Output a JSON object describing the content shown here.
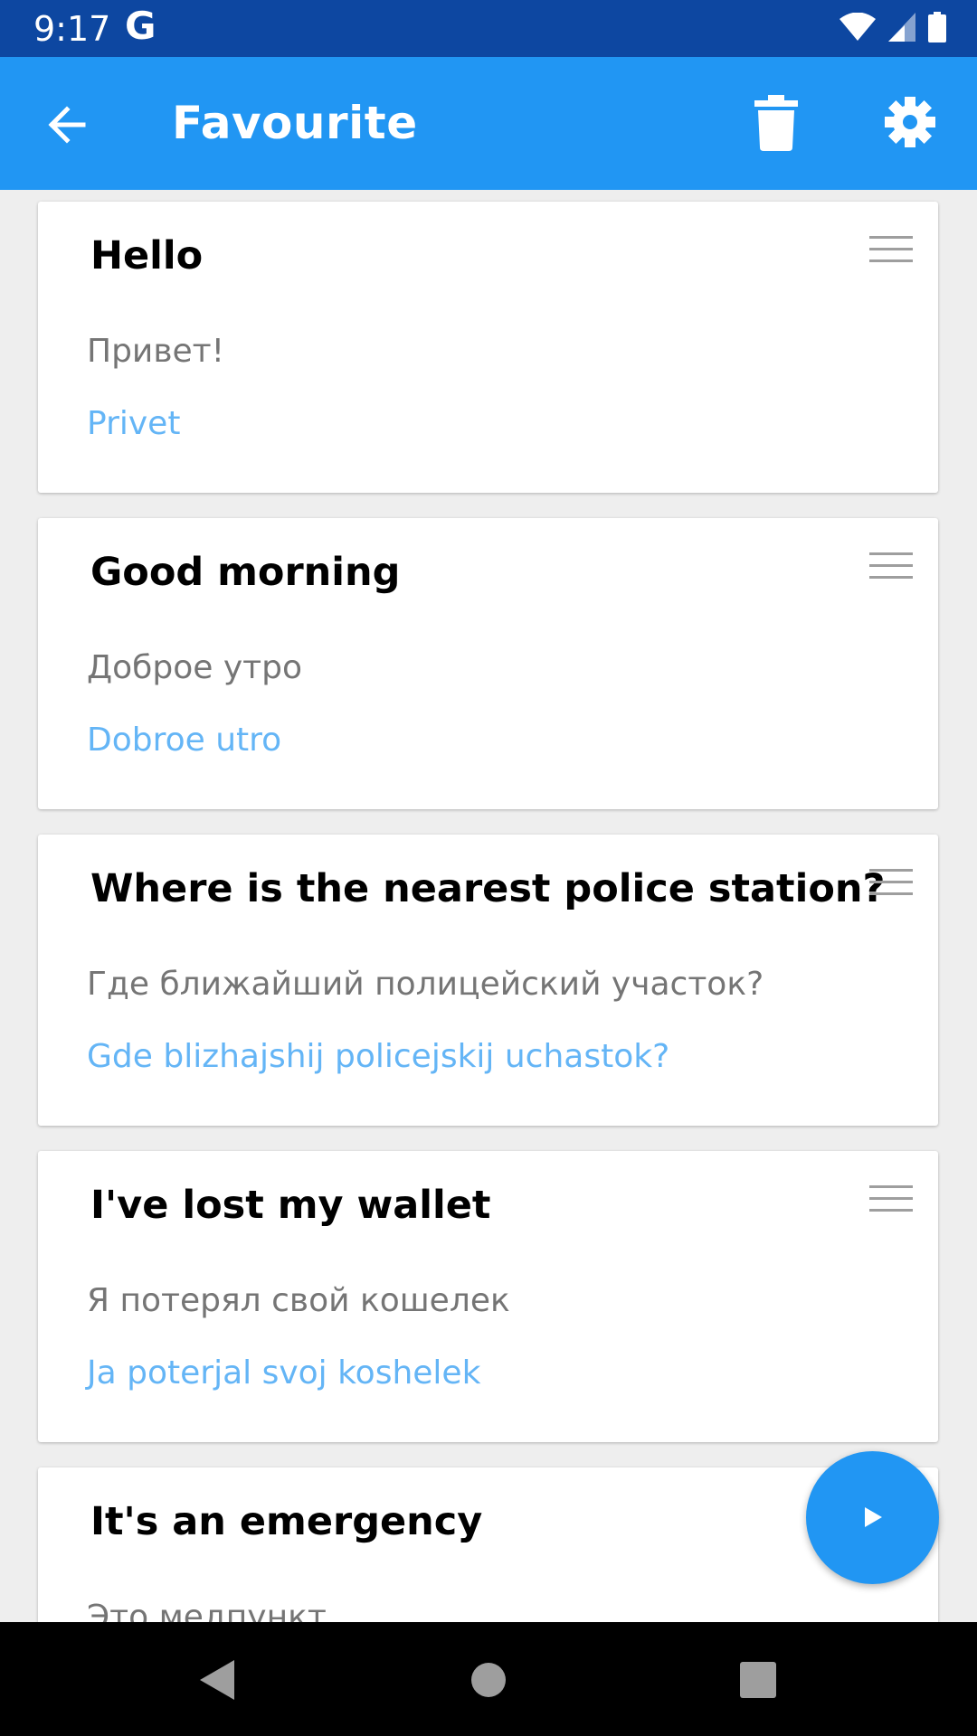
{
  "status_bar": {
    "time": "9:17",
    "app_glyph": "G",
    "icons": [
      "wifi-icon",
      "signal-icon",
      "battery-icon"
    ]
  },
  "app_bar": {
    "title": "Favourite",
    "icons": [
      "back-arrow-icon",
      "trash-icon",
      "gear-icon"
    ]
  },
  "colors": {
    "status_bar": "#0d47a1",
    "app_bar": "#2196f3",
    "transliteration": "#64b5f6",
    "translation": "#757575",
    "background": "#eeeeee"
  },
  "favourites": [
    {
      "phrase": "Hello",
      "translation": "Привет!",
      "transliteration": "Privet"
    },
    {
      "phrase": "Good morning",
      "translation": "Доброе утро",
      "transliteration": "Dobroe utro"
    },
    {
      "phrase": "Where is the nearest police station?",
      "translation": "Где ближайший полицейский участок?",
      "transliteration": "Gde blizhajshij policejskij uchastok?"
    },
    {
      "phrase": "I've lost my wallet",
      "translation": "Я потерял свой кошелек",
      "transliteration": "Ja poterjal svoj koshelek"
    },
    {
      "phrase": "It's an emergency",
      "translation": "Это медпункт"
    }
  ],
  "fab": {
    "icon": "play-icon"
  },
  "nav_bar": {
    "icons": [
      "back-triangle-icon",
      "home-circle-icon",
      "recents-square-icon"
    ]
  }
}
